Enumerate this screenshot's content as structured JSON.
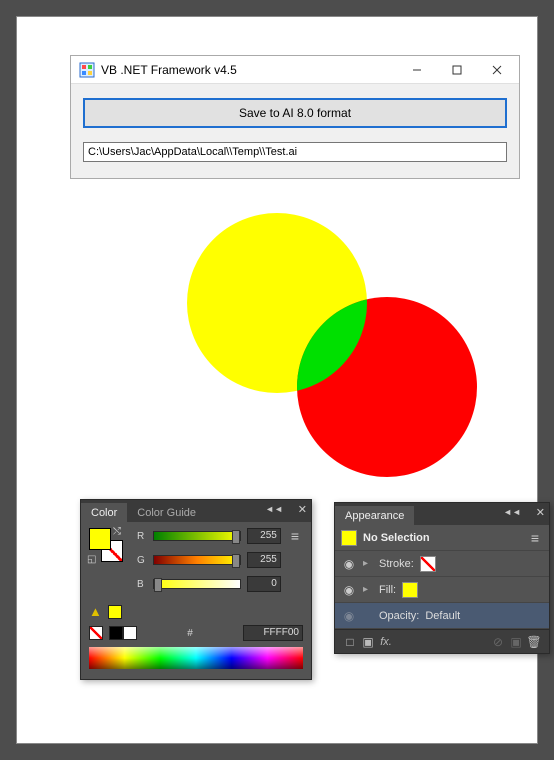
{
  "dialog": {
    "title": "VB .NET Framework v4.5",
    "save_button": "Save to AI 8.0 format",
    "path": "C:\\Users\\Jac\\AppData\\Local\\\\Temp\\\\Test.ai"
  },
  "color_panel": {
    "tab_color": "Color",
    "tab_guide": "Color Guide",
    "channels": {
      "r": {
        "label": "R",
        "value": "255"
      },
      "g": {
        "label": "G",
        "value": "255"
      },
      "b": {
        "label": "B",
        "value": "0"
      }
    },
    "hex_label": "#",
    "hex_value": "FFFF00"
  },
  "appearance_panel": {
    "tab": "Appearance",
    "no_selection": "No Selection",
    "stroke_label": "Stroke:",
    "fill_label": "Fill:",
    "opacity_label": "Opacity:",
    "opacity_value": "Default"
  },
  "graphics": {
    "fill_color": "#ffff00",
    "circle1_color": "#ffff00",
    "circle2_color": "#ff0000",
    "overlap_color": "#00ff00"
  }
}
